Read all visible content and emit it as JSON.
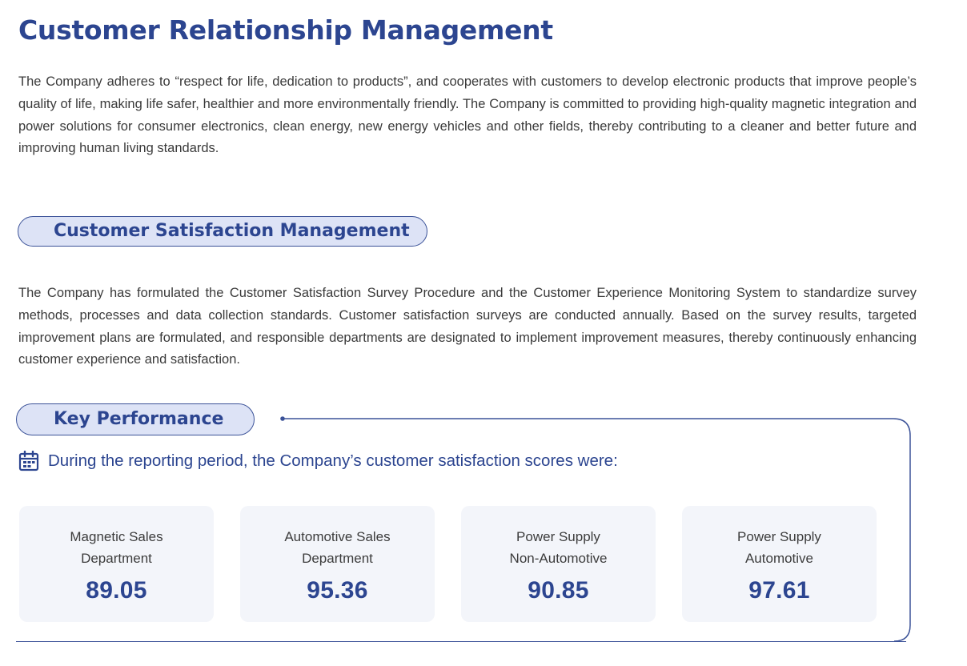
{
  "title": "Customer Relationship Management",
  "intro": "The Company adheres to “respect for life, dedication to products”, and cooperates with customers to develop electronic products that improve people’s quality of life, making life safer, healthier and more environmentally friendly. The Company is committed to providing high-quality magnetic integration and power solutions for consumer electronics, clean energy, new energy vehicles and other fields, thereby contributing to a cleaner and better future and improving human living standards.",
  "satisfaction_section": {
    "heading": "Customer Satisfaction Management",
    "body": "The Company has formulated the Customer Satisfaction Survey Procedure and the Customer Experience Monitoring System to standardize survey methods, processes and data collection standards. Customer satisfaction surveys are conducted annually. Based on the survey results, targeted improvement plans are formulated, and responsible departments are designated to implement improvement measures, thereby continuously enhancing customer experience and satisfaction."
  },
  "key_performance": {
    "heading": "Key Performance",
    "icon": "calendar-icon",
    "period_text": "During the reporting period, the Company’s customer satisfaction scores were:",
    "cards": [
      {
        "label_line1": "Magnetic Sales",
        "label_line2": "Department",
        "value": "89.05"
      },
      {
        "label_line1": "Automotive Sales",
        "label_line2": "Department",
        "value": "95.36"
      },
      {
        "label_line1": "Power Supply",
        "label_line2": "Non-Automotive",
        "value": "90.85"
      },
      {
        "label_line1": "Power Supply",
        "label_line2": "Automotive",
        "value": "97.61"
      }
    ]
  },
  "colors": {
    "brand_blue": "#2c4590",
    "pill_fill": "#dde3f6",
    "card_bg": "#f3f5fa",
    "body_text": "#3a3a3a"
  }
}
